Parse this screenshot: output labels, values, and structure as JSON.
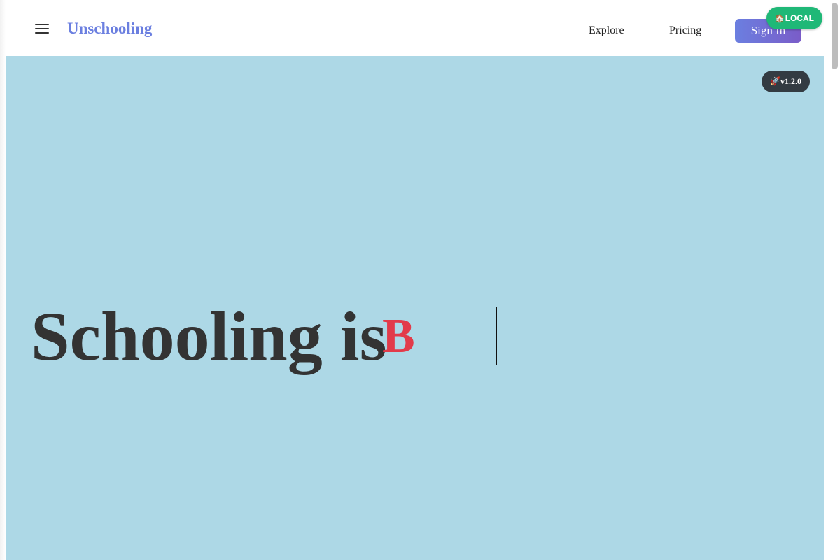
{
  "header": {
    "logo": "Unschooling",
    "nav": {
      "explore": "Explore",
      "pricing": "Pricing"
    },
    "signin_label": "Sign In",
    "menu_icon": "hamburger-menu-icon"
  },
  "env_badge": {
    "icon": "🏠",
    "label": "LOCAL",
    "color": "#1fb877"
  },
  "version_badge": {
    "icon": "🚀",
    "label": "v1.2.0"
  },
  "hero": {
    "headline": "Schooling is",
    "typed_text": "B",
    "background": "#add8e6",
    "accent_color": "#e23b4a"
  },
  "colors": {
    "brand": "#6b7fe0",
    "button_gradient_end": "#7a5cc8"
  }
}
